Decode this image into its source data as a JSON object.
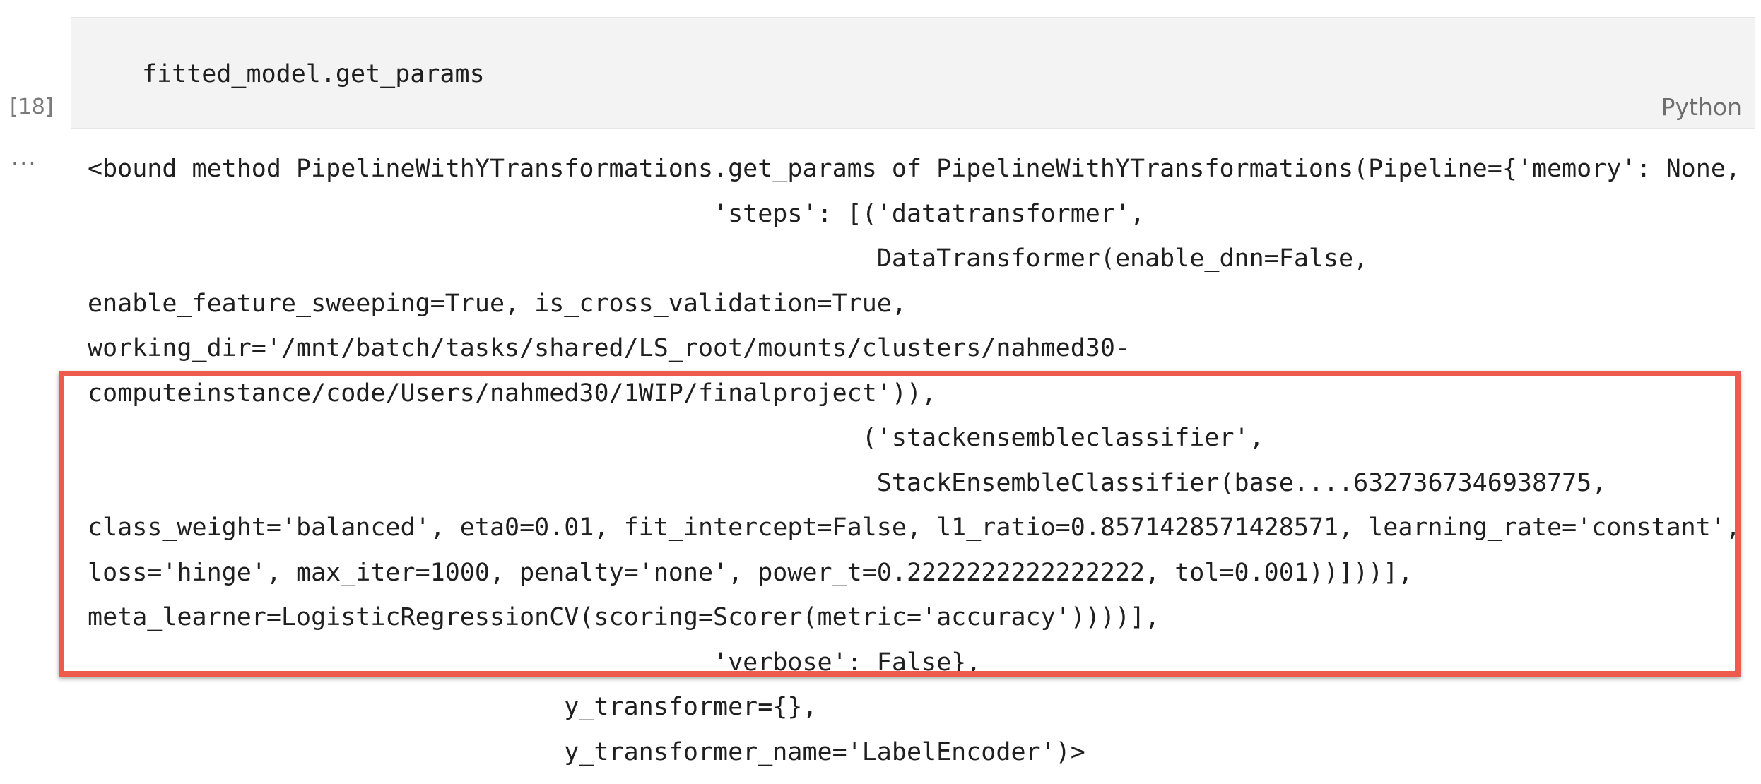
{
  "cell": {
    "execution_count": "[18]",
    "code": "fitted_model.get_params",
    "language": "Python"
  },
  "output": {
    "ellipsis": "···",
    "lines": [
      "<bound method PipelineWithYTransformations.get_params of PipelineWithYTransformations(Pipeline={'memory': None,",
      "                                          'steps': [('datatransformer',",
      "                                                     DataTransformer(enable_dnn=False,",
      "enable_feature_sweeping=True, is_cross_validation=True,",
      "working_dir='/mnt/batch/tasks/shared/LS_root/mounts/clusters/nahmed30-",
      "computeinstance/code/Users/nahmed30/1WIP/finalproject')),",
      "                                                    ('stackensembleclassifier',",
      "                                                     StackEnsembleClassifier(base....6327367346938775,",
      "class_weight='balanced', eta0=0.01, fit_intercept=False, l1_ratio=0.8571428571428571, learning_rate='constant',",
      "loss='hinge', max_iter=1000, penalty='none', power_t=0.2222222222222222, tol=0.001))]))],",
      "meta_learner=LogisticRegressionCV(scoring=Scorer(metric='accuracy'))))],",
      "                                          'verbose': False},",
      "                                y_transformer={},",
      "                                y_transformer_name='LabelEncoder')>"
    ]
  },
  "colors": {
    "highlight_border": "#ee5a4c",
    "cell_background": "#f3f3f3"
  }
}
